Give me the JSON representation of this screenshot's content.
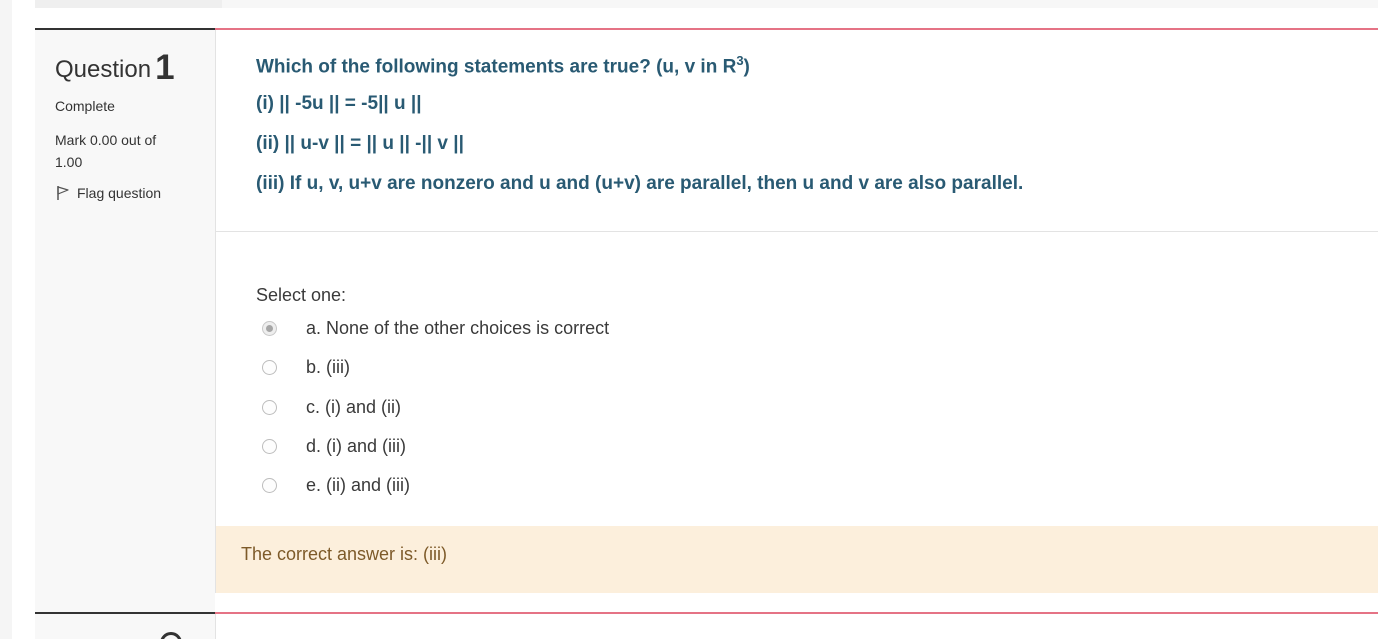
{
  "question": {
    "label": "Question",
    "number": "1",
    "state": "Complete",
    "grade": "Mark 0.00 out of 1.00",
    "flag_label": "Flag question"
  },
  "question_text": {
    "line1_main": "Which of the following statements are true? (u, v in R",
    "line1_sup": "3",
    "line1_end": ")",
    "line2": "(i) || -5u || = -5|| u ||",
    "line3": "(ii) || u-v || = || u || -|| v ||",
    "line4": "(iii) If u, v, u+v are nonzero and u and (u+v) are parallel, then u and v are also parallel."
  },
  "answer": {
    "prompt": "Select one:",
    "options": [
      {
        "label": "a. None of the other choices is correct",
        "selected": true
      },
      {
        "label": "b. (iii)",
        "selected": false
      },
      {
        "label": "c. (i) and (ii)",
        "selected": false
      },
      {
        "label": "d. (i) and (iii)",
        "selected": false
      },
      {
        "label": "e. (ii) and (iii)",
        "selected": false
      }
    ]
  },
  "feedback": {
    "text": "The correct answer is: (iii)"
  },
  "colors": {
    "question_text": "#295a73",
    "accent_rule": "#e57385",
    "feedback_bg": "#fcefdc",
    "feedback_text": "#7d5a29"
  },
  "icons": {
    "flag": "flag-icon",
    "radio": "radio-icon"
  }
}
